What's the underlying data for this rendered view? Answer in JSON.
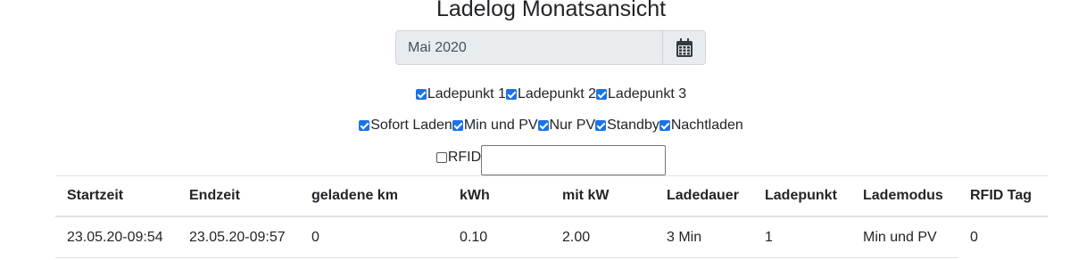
{
  "page": {
    "title": "Ladelog Monatsansicht"
  },
  "month_picker": {
    "value": "Mai 2020",
    "icon": "calendar-icon"
  },
  "filters": {
    "ladepunkte": [
      {
        "label": "Ladepunkt 1",
        "checked": true
      },
      {
        "label": "Ladepunkt 2",
        "checked": true
      },
      {
        "label": "Ladepunkt 3",
        "checked": true
      }
    ],
    "modes": [
      {
        "label": "Sofort Laden",
        "checked": true
      },
      {
        "label": "Min und PV",
        "checked": true
      },
      {
        "label": "Nur PV",
        "checked": true
      },
      {
        "label": "Standby",
        "checked": true
      },
      {
        "label": "Nachtladen",
        "checked": true
      }
    ],
    "rfid": {
      "label": "RFID",
      "checked": false,
      "value": ""
    }
  },
  "table": {
    "headers": [
      "Startzeit",
      "Endzeit",
      "geladene km",
      "kWh",
      "mit kW",
      "Ladedauer",
      "Ladepunkt",
      "Lademodus",
      "RFID Tag"
    ],
    "rows": [
      [
        "23.05.20-09:54",
        "23.05.20-09:57",
        "0",
        "0.10",
        "2.00",
        "3 Min",
        "1",
        "Min und PV",
        "0"
      ]
    ]
  }
}
